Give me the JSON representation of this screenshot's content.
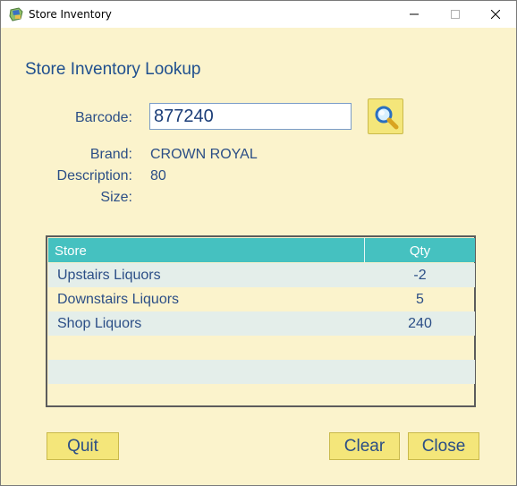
{
  "window": {
    "title": "Store Inventory",
    "app_icon": "store-inventory-app-icon",
    "controls": [
      "minimize-icon",
      "maximize-icon",
      "close-icon"
    ]
  },
  "form": {
    "heading": "Store Inventory Lookup",
    "barcode_label": "Barcode:",
    "barcode_value": "877240",
    "search_icon": "magnifier-search-icon",
    "brand_label": "Brand:",
    "brand_value": "CROWN ROYAL",
    "description_label": "Description:",
    "description_value": "80",
    "size_label": "Size:",
    "size_value": ""
  },
  "grid": {
    "columns": [
      "Store",
      "Qty"
    ],
    "rows": [
      {
        "store": "Upstairs Liquors",
        "qty": "-2"
      },
      {
        "store": "Downstairs Liquors",
        "qty": "5"
      },
      {
        "store": "Shop Liquors",
        "qty": "240"
      },
      {
        "store": "",
        "qty": ""
      },
      {
        "store": "",
        "qty": ""
      },
      {
        "store": "",
        "qty": ""
      }
    ]
  },
  "buttons": {
    "quit": "Quit",
    "clear": "Clear",
    "close": "Close"
  },
  "colors": {
    "background": "#fbf3cc",
    "header": "#45c1c0",
    "button": "#f4e67a",
    "text": "#2b4e86"
  }
}
